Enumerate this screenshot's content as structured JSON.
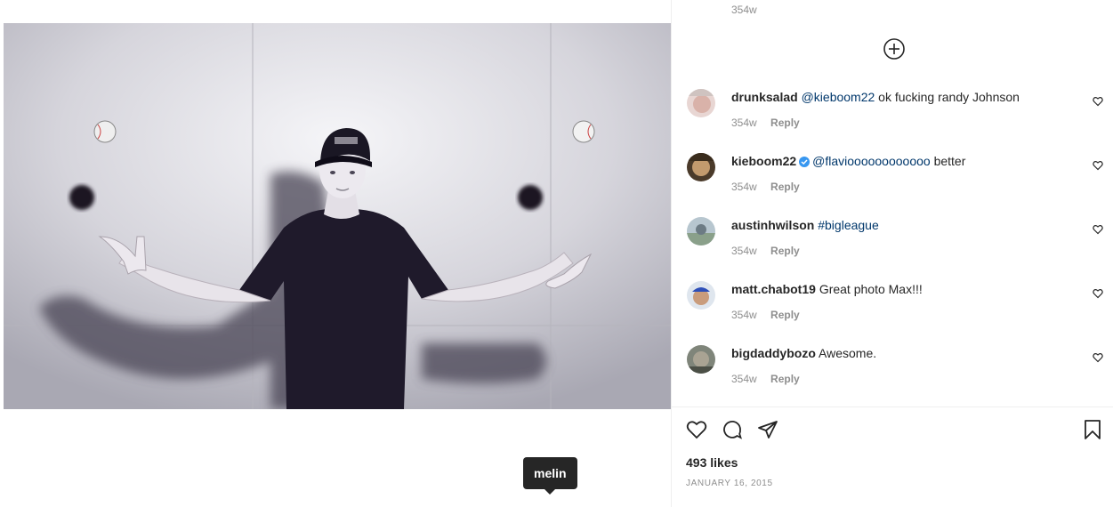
{
  "tooltip": {
    "label": "melin"
  },
  "panel": {
    "top_timestamp": "354w",
    "load_more_icon": "plus-circle-icon"
  },
  "comments": [
    {
      "username": "drunksalad",
      "mention": "@kieboom22",
      "text": " ok fucking randy Johnson",
      "time": "354w",
      "reply": "Reply",
      "verified": false
    },
    {
      "username": "kieboom22",
      "mention": "@flavioooooooooooo",
      "text": " better",
      "time": "354w",
      "reply": "Reply",
      "verified": true
    },
    {
      "username": "austinhwilson",
      "mention": "#bigleague",
      "text": "",
      "time": "354w",
      "reply": "Reply",
      "verified": false
    },
    {
      "username": "matt.chabot19",
      "mention": "",
      "text": "Great photo Max!!!",
      "time": "354w",
      "reply": "Reply",
      "verified": false
    },
    {
      "username": "bigdaddybozo",
      "mention": "",
      "text": "Awesome.",
      "time": "354w",
      "reply": "Reply",
      "verified": false
    }
  ],
  "actions": {
    "icons": [
      "heart-icon",
      "comment-icon",
      "share-icon",
      "bookmark-icon"
    ],
    "likes": "493 likes",
    "date": "JANUARY 16, 2015"
  },
  "colors": {
    "text": "#262626",
    "muted": "#8e8e8e",
    "link": "#00376b",
    "verified": "#3897f0"
  }
}
